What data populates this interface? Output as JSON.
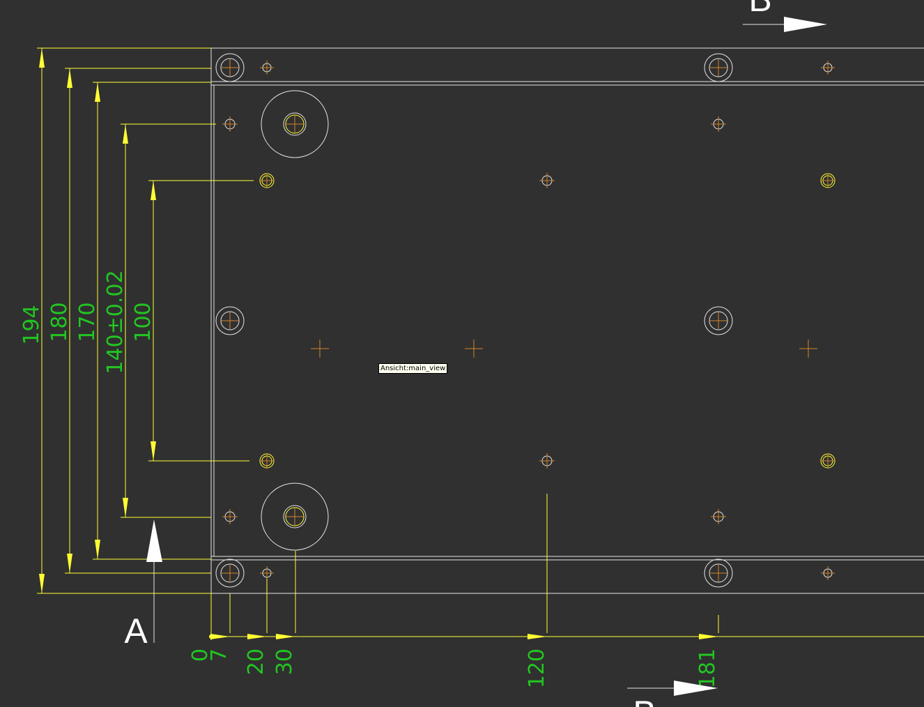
{
  "drawing": {
    "background": "#303030",
    "colors": {
      "outline": "#e6e6e6",
      "dimension": "#ffff33",
      "dim_text": "#22c622",
      "center_mark": "#d4832a"
    },
    "section_labels": {
      "top_right": "B",
      "left": "A",
      "bottom": "B"
    },
    "vertical_dimensions": [
      {
        "label": "194"
      },
      {
        "label": "180"
      },
      {
        "label": "170"
      },
      {
        "label": "140±0.02"
      },
      {
        "label": "100"
      }
    ],
    "ordinate_dimensions": [
      {
        "label": "0"
      },
      {
        "label": "7"
      },
      {
        "label": "20"
      },
      {
        "label": "30"
      },
      {
        "label": "120"
      },
      {
        "label": "181"
      }
    ],
    "tooltip": "Ansicht:main_view"
  }
}
